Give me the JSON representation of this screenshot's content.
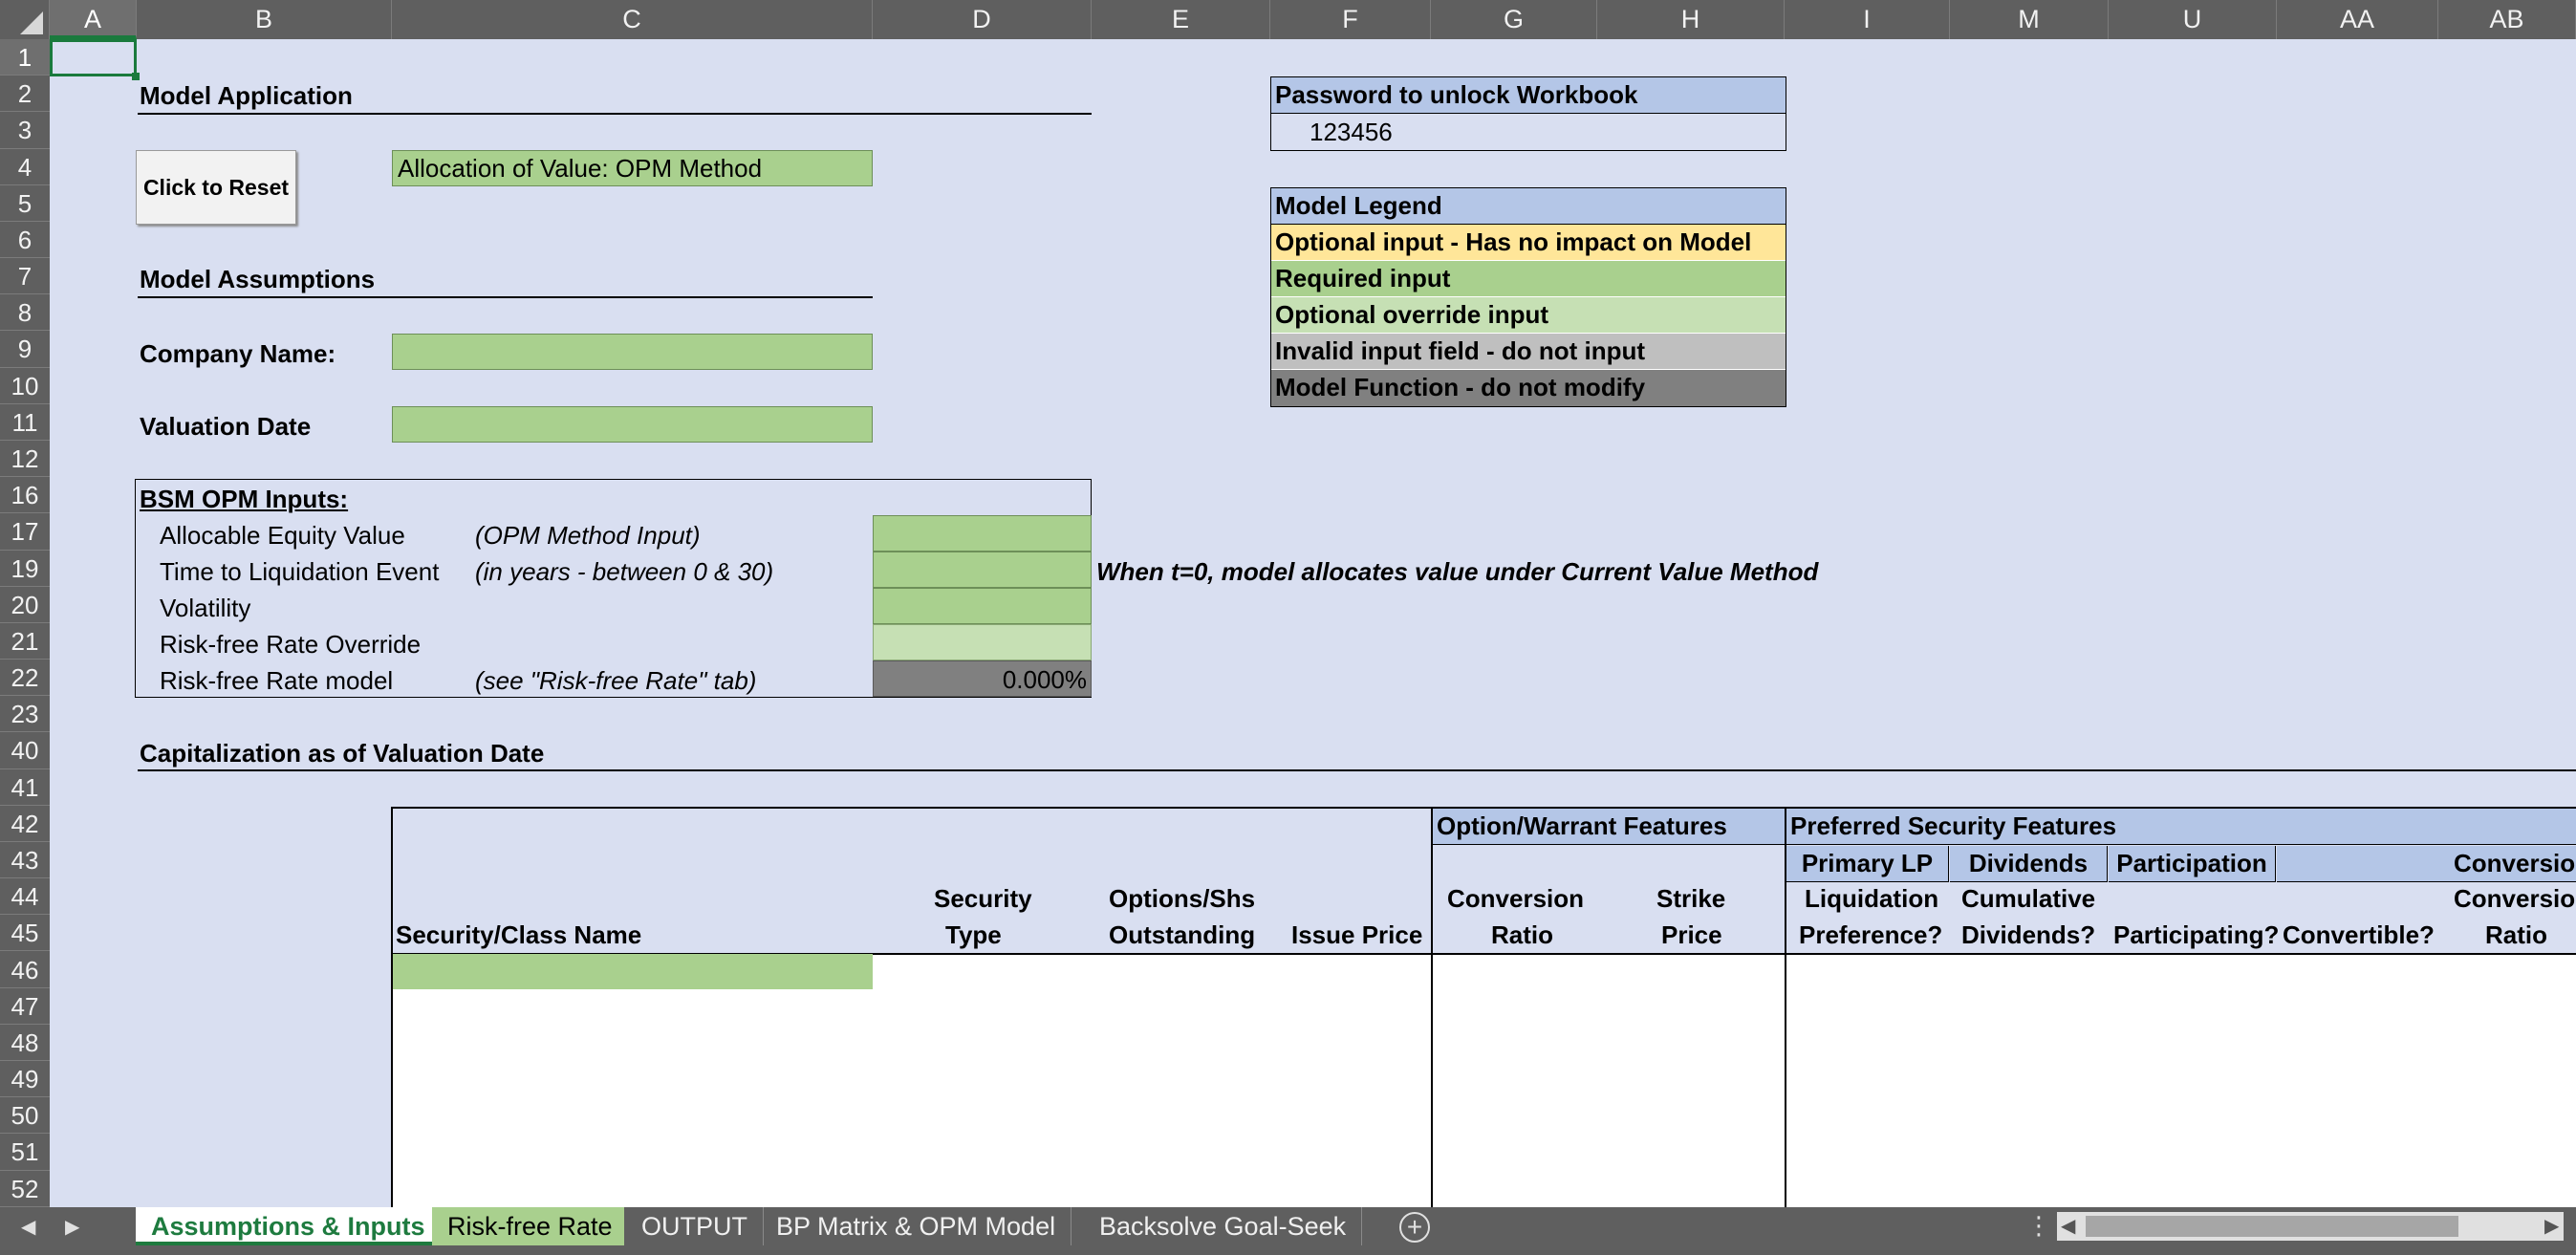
{
  "columns": [
    "A",
    "B",
    "C",
    "D",
    "E",
    "F",
    "G",
    "H",
    "I",
    "M",
    "U",
    "AA",
    "AB"
  ],
  "rows": [
    "1",
    "2",
    "3",
    "4",
    "5",
    "6",
    "7",
    "8",
    "9",
    "10",
    "11",
    "12",
    "16",
    "17",
    "19",
    "20",
    "21",
    "22",
    "23",
    "40",
    "41",
    "42",
    "43",
    "44",
    "45",
    "46",
    "47",
    "48",
    "49",
    "50",
    "51",
    "52"
  ],
  "model_application": {
    "title": "Model Application",
    "reset_button": "Click to Reset",
    "method": "Allocation of Value: OPM Method"
  },
  "password": {
    "label": "Password to unlock Workbook",
    "value": "123456"
  },
  "legend": {
    "title": "Model Legend",
    "items": [
      {
        "label": "Optional input - Has no impact on Model",
        "color": "#ffe699"
      },
      {
        "label": "Required input",
        "color": "#a9d08e"
      },
      {
        "label": "Optional override input",
        "color": "#c6e0b4"
      },
      {
        "label": "Invalid input field - do not input",
        "color": "#bfbfbf"
      },
      {
        "label": "Model Function - do not modify",
        "color": "#808080"
      }
    ]
  },
  "assumptions": {
    "title": "Model Assumptions",
    "company_label": "Company Name:",
    "company_value": "",
    "date_label": "Valuation Date",
    "date_value": ""
  },
  "bsm": {
    "title": "BSM OPM Inputs:",
    "rows": [
      {
        "label": "Allocable Equity Value",
        "note": "(OPM Method Input)",
        "value": ""
      },
      {
        "label": "Time to Liquidation Event",
        "note": "(in years - between 0 & 30)",
        "value": ""
      },
      {
        "label": "Volatility",
        "note": "",
        "value": ""
      },
      {
        "label": "Risk-free Rate Override",
        "note": "",
        "value": ""
      },
      {
        "label": "Risk-free Rate model",
        "note": "(see \"Risk-free Rate\" tab)",
        "value": "0.000%"
      }
    ],
    "t0_note": "When t=0, model allocates value under Current Value Method"
  },
  "capitalization": {
    "title": "Capitalization as of Valuation Date",
    "option_group": "Option/Warrant Features",
    "preferred_group": "Preferred Security Features",
    "subgroups": [
      "Primary LP",
      "Dividends",
      "Participation",
      "Conversion"
    ],
    "headers": {
      "class_name": "Security/Class Name",
      "security_type_1": "Security",
      "security_type_2": "Type",
      "options_1": "Options/Shs",
      "options_2": "Outstanding",
      "issue_price": "Issue Price",
      "conv_ratio_1": "Conversion",
      "conv_ratio_2": "Ratio",
      "strike_1": "Strike",
      "strike_2": "Price",
      "liq_1": "Liquidation",
      "liq_2": "Preference?",
      "div_1": "Cumulative",
      "div_2": "Dividends?",
      "participating": "Participating?",
      "convertible": "Convertible?",
      "conv2_1": "Conversion",
      "conv2_2": "Ratio"
    }
  },
  "tabs": [
    "Assumptions & Inputs",
    "Risk-free Rate",
    "OUTPUT",
    "BP Matrix & OPM Model",
    "Backsolve Goal-Seek"
  ],
  "colors": {
    "sheet_bg": "#d9dff1",
    "header_bg": "#5f5f5f",
    "required": "#a9d08e",
    "override": "#c6e0b4",
    "blue_header": "#b4c6e7",
    "active_tab": "#1e7b3f"
  }
}
